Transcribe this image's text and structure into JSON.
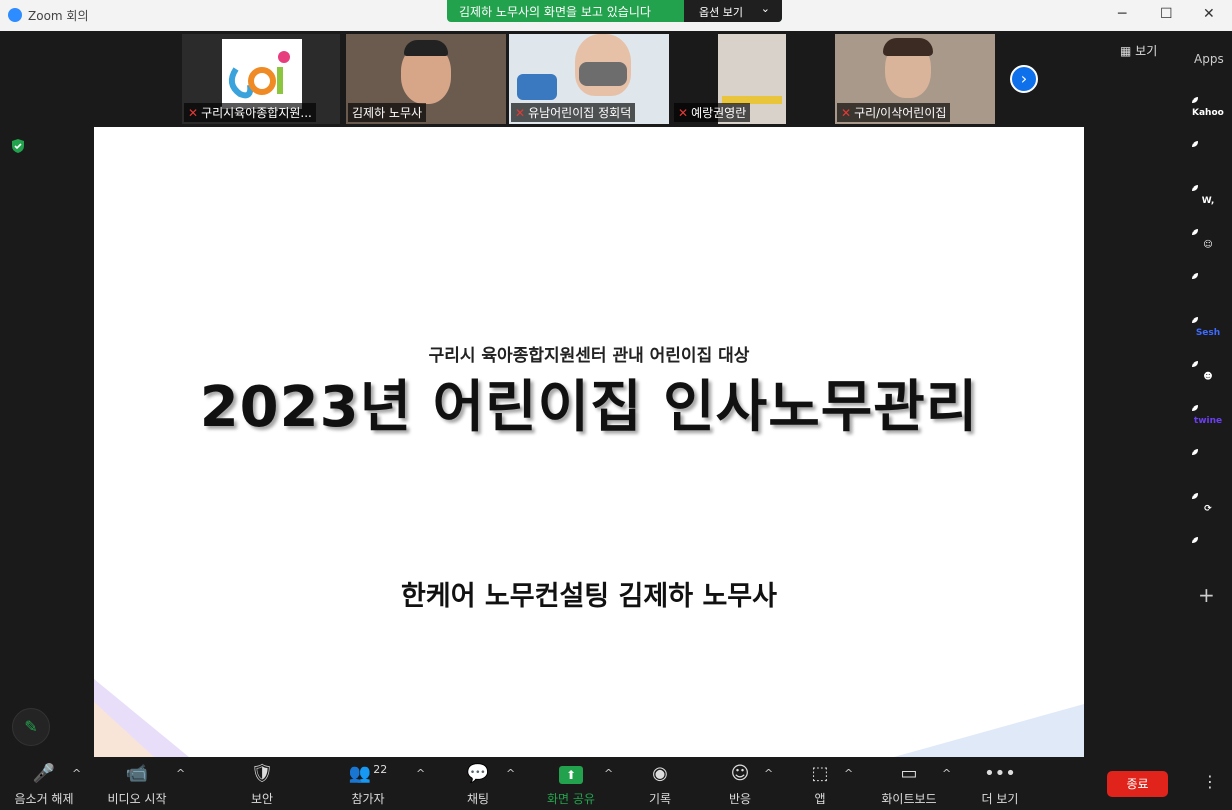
{
  "window": {
    "title": "Zoom 회의",
    "controls": [
      "─",
      "☐",
      "✕"
    ]
  },
  "share_banner": {
    "text": "김제하 노무사의 화면을 보고 있습니다",
    "options_label": "옵션 보기",
    "chevron": "⌄"
  },
  "gallery": {
    "participants": [
      {
        "name": "구리시육아종합지원...",
        "muted": true
      },
      {
        "name": "김제하 노무사",
        "muted": false
      },
      {
        "name": "유남어린이집 정회덕",
        "muted": true
      },
      {
        "name": "예랑권영란",
        "muted": true
      },
      {
        "name": "구리/이삭어린이집",
        "muted": true
      }
    ],
    "next_arrow": "›"
  },
  "view_button": {
    "icon": "▦",
    "label": "보기"
  },
  "apps": {
    "label": "Apps",
    "items": [
      {
        "name": "kahoot",
        "text": "Kahoot!",
        "color": "#46178f"
      },
      {
        "name": "app-2",
        "text": "",
        "color": "#ff5a1f"
      },
      {
        "name": "app-3",
        "text": "W,",
        "color": "#6a3ff0"
      },
      {
        "name": "app-4",
        "text": "☺",
        "color": "#3d6bff"
      },
      {
        "name": "app-5",
        "text": "",
        "color": "#c01e8c"
      },
      {
        "name": "sesh",
        "text": "Sesh",
        "color": "#ffffff"
      },
      {
        "name": "app-7",
        "text": "☻",
        "color": "#f7c531"
      },
      {
        "name": "twine",
        "text": "twine",
        "color": "#ffffff"
      },
      {
        "name": "app-9",
        "text": "",
        "color": "#ffffff"
      },
      {
        "name": "app-10",
        "text": "⟳",
        "color": "#2f4b8a"
      },
      {
        "name": "app-11",
        "text": "",
        "color": "#1d7ef0"
      }
    ],
    "add": "+"
  },
  "slide": {
    "subtitle": "구리시 육아종합지원센터 관내 어린이집 대상",
    "title": "2023년 어린이집 인사노무관리",
    "presenter": "한케어 노무컨설팅  김제하 노무사"
  },
  "toolbar": {
    "mute": {
      "label": "음소거 해제",
      "icon": "🎤"
    },
    "video": {
      "label": "비디오 시작",
      "icon": "📹"
    },
    "security": {
      "label": "보안",
      "icon": "🛡"
    },
    "participants": {
      "label": "참가자",
      "count": "22",
      "icon": "👥"
    },
    "chat": {
      "label": "채팅",
      "icon": "💬"
    },
    "share": {
      "label": "화면 공유",
      "icon": "⬆"
    },
    "record": {
      "label": "기록",
      "icon": "◉"
    },
    "reactions": {
      "label": "반응",
      "icon": "☺"
    },
    "apps": {
      "label": "앱",
      "icon": "⬚"
    },
    "whiteboard": {
      "label": "화이트보드",
      "icon": "▭"
    },
    "more": {
      "label": "더 보기",
      "icon": "•••"
    },
    "end": {
      "label": "종료"
    },
    "caret": "^"
  },
  "colors": {
    "accent": "#0e71eb",
    "share_green": "#23a24d",
    "end_red": "#e0241b"
  }
}
